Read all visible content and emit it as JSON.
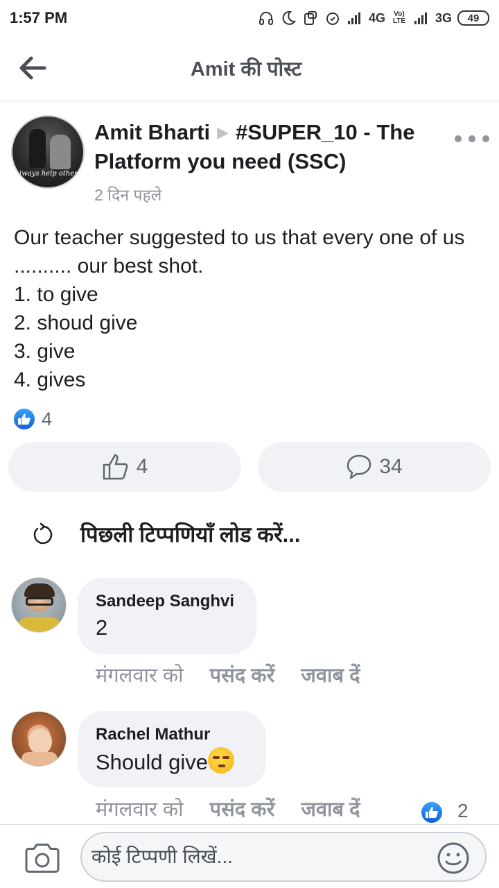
{
  "status_bar": {
    "time": "1:57 PM",
    "network_1": "4G",
    "volte": "Vo) LTE",
    "network_2": "3G",
    "battery": "49"
  },
  "header": {
    "title": "Amit की पोस्ट"
  },
  "post": {
    "author": "Amit Bharti",
    "group": "#SUPER_10 - The Platform you need (SSC)",
    "avatar_caption": "Always help others",
    "time": "2 दिन पहले",
    "body": "Our teacher suggested to us that every one of us .......... our best shot.\n1. to give\n2. shoud give\n3. give\n4. gives",
    "reaction_count": "4",
    "like_count": "4",
    "comment_count": "34"
  },
  "load_previous": {
    "label": "पिछली टिप्पणियाँ लोड करें..."
  },
  "comments": [
    {
      "name": "Sandeep Sanghvi",
      "text": "2",
      "time": "मंगलवार को",
      "like_label": "पसंद करें",
      "reply_label": "जवाब दें"
    },
    {
      "name": "Rachel Mathur",
      "text": "Should give",
      "time": "मंगलवार को",
      "like_label": "पसंद करें",
      "reply_label": "जवाब दें",
      "reaction_count": "2"
    }
  ],
  "composer": {
    "placeholder": "कोई टिप्पणी लिखें..."
  },
  "colors": {
    "facebook_blue": "#1877f2",
    "gray_text": "#90949c",
    "bubble_bg": "#f0f2f5"
  },
  "icons": {
    "back": "arrow-left-icon",
    "more": "more-dots-icon",
    "like": "thumbs-up-icon",
    "comment": "comment-bubble-icon",
    "reload": "reload-icon",
    "camera": "camera-icon",
    "emoji": "smiley-icon"
  }
}
